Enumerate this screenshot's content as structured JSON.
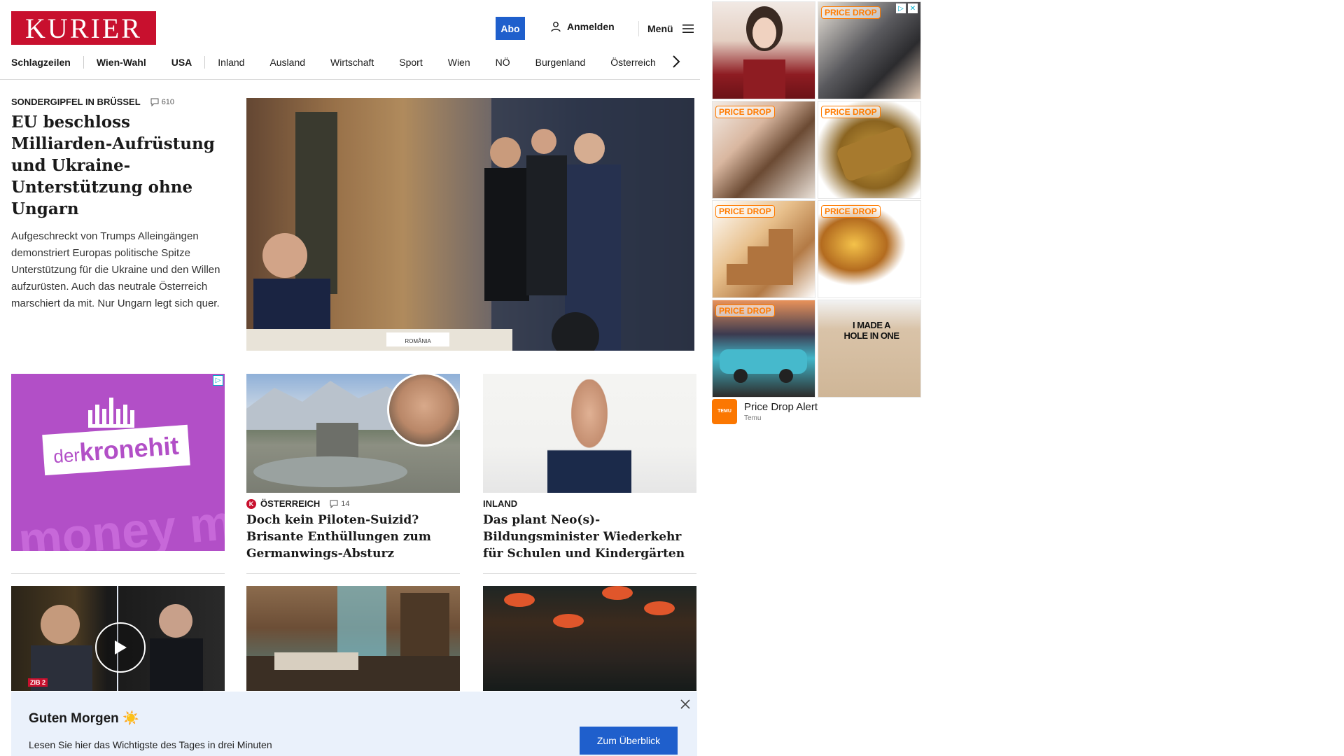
{
  "header": {
    "logo_text": "KURIER",
    "abo_label": "Abo",
    "login_label": "Anmelden",
    "menu_label": "Menü"
  },
  "nav": {
    "items": [
      "Schlagzeilen",
      "Wien-Wahl",
      "USA",
      "Inland",
      "Ausland",
      "Wirtschaft",
      "Sport",
      "Wien",
      "NÖ",
      "Burgenland",
      "Österreich"
    ]
  },
  "lead": {
    "kicker": "SONDERGIPFEL IN BRÜSSEL",
    "comments": "610",
    "title": "EU beschloss Milliarden-Aufrüstung und Ukraine-Unterstützung ohne Ungarn",
    "teaser": "Aufgeschreckt von Trumps Alleingängen demonstriert Europas politische Spitze Unterstützung für die Ukraine und den Willen aufzurüsten. Auch das neutrale Österreich marschiert da mit. Nur Ungarn legt sich quer.",
    "image_label": "ROMÂNIA"
  },
  "ad_left": {
    "brand_prefix": "der",
    "brand_main": "kronehit",
    "bg_text": "money m"
  },
  "tiles": [
    {
      "kicker_icon": "K",
      "kicker": "ÖSTERREICH",
      "comments": "14",
      "title": "Doch kein Piloten-Suizid? Brisante Enthüllungen zum Germanwings-Absturz"
    },
    {
      "kicker": "INLAND",
      "title": "Das plant Neo(s)-Bildungsminister Wiederkehr für Schulen und Kindergärten"
    }
  ],
  "video_tile": {
    "badge": "ZIB 2"
  },
  "banner": {
    "title": "Guten Morgen ☀️",
    "text": "Lesen Sie hier das Wichtigste des Tages in drei Minuten",
    "button": "Zum Überblick"
  },
  "ads_right": {
    "badge": "PRICE DROP",
    "shirt_text": "I MADE A HOLE IN ONE",
    "title": "Price Drop Alert",
    "source": "Temu",
    "logo_text": "TEMU"
  },
  "colors": {
    "brand_red": "#c8102e",
    "button_blue": "#1f5fcc",
    "banner_bg": "#eaf1fb",
    "price_drop_orange": "#ff7b00"
  }
}
